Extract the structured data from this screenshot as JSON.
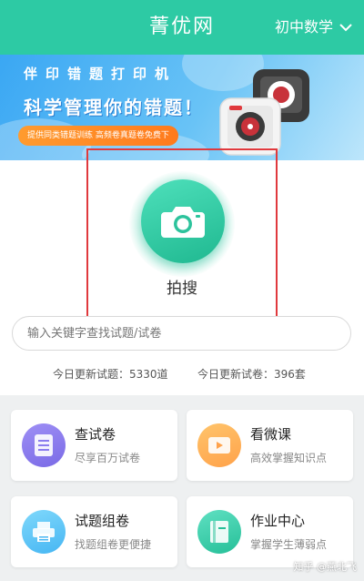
{
  "header": {
    "title": "菁优网",
    "subject": "初中数学"
  },
  "banner": {
    "line1": "伴印错题打印机",
    "line2": "科学管理你的错题！",
    "pill": "提供同类错题训练  高频卷真题卷免费下"
  },
  "camera": {
    "label": "拍搜"
  },
  "search": {
    "placeholder": "输入关键字查找试题/试卷"
  },
  "stats": {
    "questions": "今日更新试题：5330道",
    "papers": "今日更新试卷：396套"
  },
  "cards": [
    {
      "title": "查试卷",
      "desc": "尽享百万试卷"
    },
    {
      "title": "看微课",
      "desc": "高效掌握知识点"
    },
    {
      "title": "试题组卷",
      "desc": "找题组卷更便捷"
    },
    {
      "title": "作业中心",
      "desc": "掌握学生薄弱点"
    }
  ],
  "watermark": "知乎 @燕北飞"
}
